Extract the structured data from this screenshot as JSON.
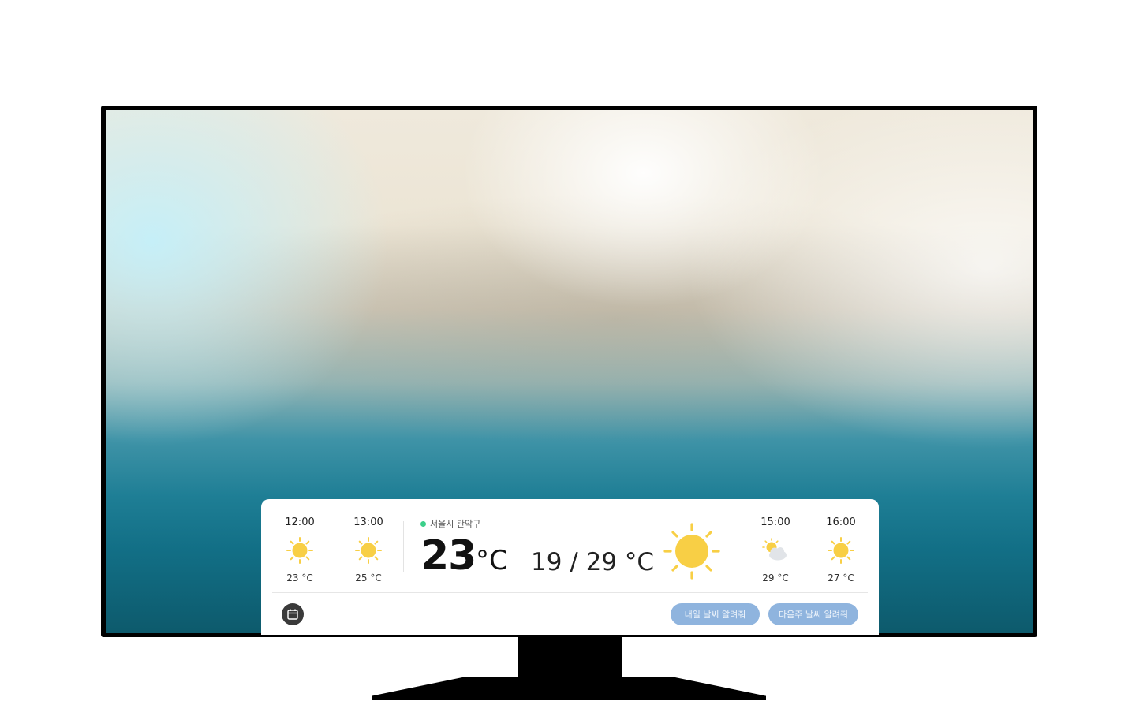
{
  "weather": {
    "location": "서울시 관악구",
    "current_temp": "23",
    "current_unit": "°C",
    "range": "19 / 29 °C",
    "current_icon": "sun-icon",
    "hourly_left": [
      {
        "time": "12:00",
        "temp": "23 °C",
        "icon": "sun-icon"
      },
      {
        "time": "13:00",
        "temp": "25 °C",
        "icon": "sun-icon"
      }
    ],
    "hourly_right": [
      {
        "time": "15:00",
        "temp": "29 °C",
        "icon": "partly-cloudy-icon"
      },
      {
        "time": "16:00",
        "temp": "27 °C",
        "icon": "sun-icon"
      }
    ]
  },
  "actions": {
    "tomorrow_label": "내일 날씨 알려줘",
    "next_week_label": "다음주 날씨 알려줘",
    "calendar_icon": "calendar-icon"
  },
  "colors": {
    "sun": "#f8cf45",
    "pill": "#8fb4de",
    "location_dot": "#3ccf8a",
    "tv_frame": "#000000"
  }
}
